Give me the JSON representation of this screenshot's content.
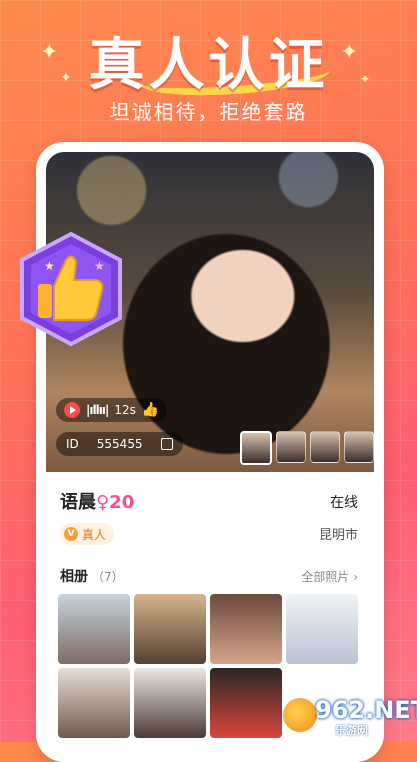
{
  "header": {
    "title": "真人认证",
    "subtitle": "坦诚相待，拒绝套路"
  },
  "profile": {
    "voice_duration": "12s",
    "id_label": "ID",
    "id_value": "555455",
    "name": "语晨",
    "gender_age": "♀20",
    "status": "在线",
    "verified_label": "真人",
    "city": "昆明市"
  },
  "album": {
    "title": "相册",
    "count": "（7）",
    "view_all": "全部照片 ›"
  },
  "watermark": {
    "brand": "962.NET",
    "sub": "乐游网"
  },
  "colors": {
    "accent": "#ff5f73",
    "verified": "#e27a18",
    "gender": "#ff4f8a"
  }
}
